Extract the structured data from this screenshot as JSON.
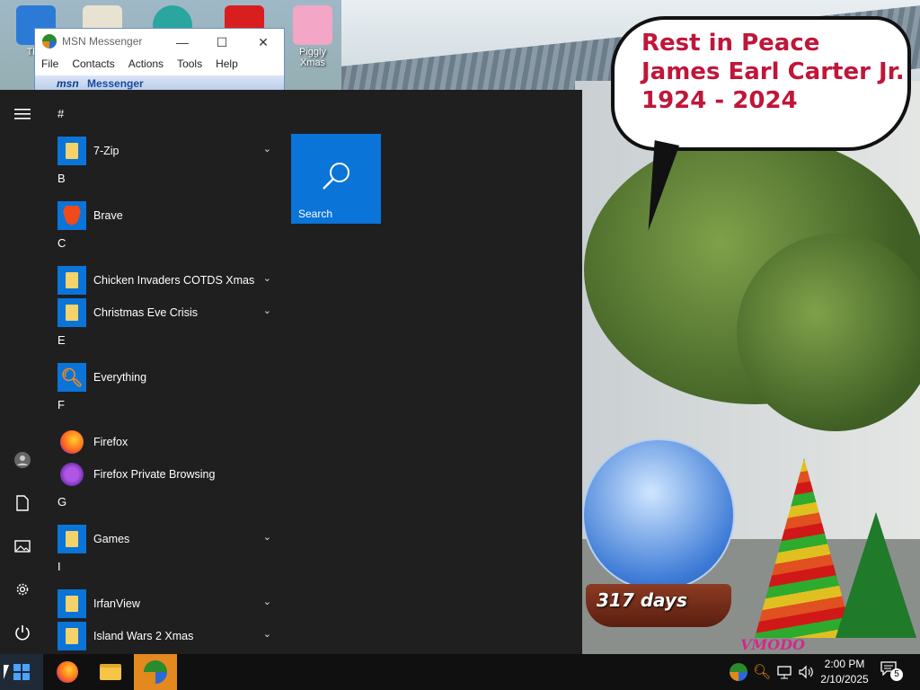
{
  "desktop": {
    "icons": [
      {
        "label": "This",
        "color": "#2b7bd6"
      },
      {
        "label": "",
        "color": "#e8e2d0"
      },
      {
        "label": "",
        "color": "#2aa5a0"
      },
      {
        "label": "",
        "color": "#d81e1e"
      },
      {
        "label": "Piggly Xmas",
        "color": "#f3a6c6"
      }
    ],
    "banner": {
      "line1": "Rest in Peace",
      "line2": "James Earl Carter Jr.",
      "line3": "1924 - 2024"
    },
    "countdown": "317 days",
    "watermark": "VMODO"
  },
  "msn": {
    "title": "MSN Messenger",
    "minimize": "—",
    "maximize": "☐",
    "close": "✕",
    "menu": [
      "File",
      "Contacts",
      "Actions",
      "Tools",
      "Help"
    ],
    "band_logo": "msn",
    "band_text": "Messenger"
  },
  "start": {
    "rail": {
      "menu_icon": "hamburger-icon",
      "user_icon": "user-icon",
      "documents_icon": "document-icon",
      "pictures_icon": "pictures-icon",
      "settings_icon": "gear-icon",
      "power_icon": "power-icon"
    },
    "groups": [
      {
        "letter": "#",
        "apps": [
          {
            "name": "7-Zip",
            "icon": "folder",
            "expandable": true
          }
        ]
      },
      {
        "letter": "B",
        "apps": [
          {
            "name": "Brave",
            "icon": "brave",
            "expandable": false
          }
        ]
      },
      {
        "letter": "C",
        "apps": [
          {
            "name": "Chicken Invaders COTDS Xmas",
            "icon": "folder",
            "expandable": true
          },
          {
            "name": "Christmas Eve Crisis",
            "icon": "folder",
            "expandable": true
          }
        ]
      },
      {
        "letter": "E",
        "apps": [
          {
            "name": "Everything",
            "icon": "everything",
            "expandable": false
          }
        ]
      },
      {
        "letter": "F",
        "apps": [
          {
            "name": "Firefox",
            "icon": "firefox",
            "expandable": false
          },
          {
            "name": "Firefox Private Browsing",
            "icon": "firefox-private",
            "expandable": false
          }
        ]
      },
      {
        "letter": "G",
        "apps": [
          {
            "name": "Games",
            "icon": "folder",
            "expandable": true
          }
        ]
      },
      {
        "letter": "I",
        "apps": [
          {
            "name": "IrfanView",
            "icon": "folder",
            "expandable": true
          },
          {
            "name": "Island Wars 2 Xmas",
            "icon": "folder",
            "expandable": true
          }
        ]
      }
    ],
    "tile": {
      "label": "Search",
      "icon": "search-icon",
      "color": "#0a74d8"
    }
  },
  "taskbar": {
    "active_color": "#e4891f",
    "clock_time": "2:00 PM",
    "clock_date": "2/10/2025",
    "notification_count": "5"
  }
}
